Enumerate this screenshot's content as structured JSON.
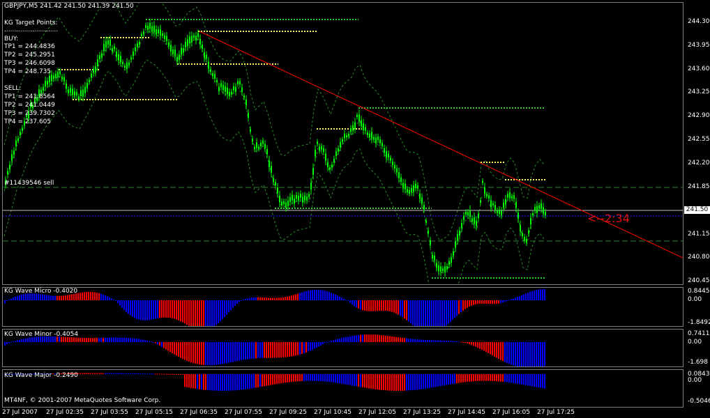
{
  "chart": {
    "symbol_header": "GBPJPY,M5  241.42 241.50 241.39 241.50",
    "panel_title": "KG Target Points:",
    "dotted_line": "...........................",
    "buy_header": "BUY:",
    "buy_tp1": "TP1 = 244.4836",
    "buy_tp2": "TP2 = 245.2951",
    "buy_tp3": "TP3 = 246.6098",
    "buy_tp4": "TP4 = 248.735",
    "sell_header": "SELL:",
    "sell_tp1": "TP1 = 241.8564",
    "sell_tp2": "TP2 = 241.0449",
    "sell_tp3": "TP3 = 239.7302",
    "sell_tp4": "TP4 = 237.605",
    "order_label": "#11439546 sell",
    "countdown": "<--2:34",
    "current_price": "241.50",
    "copyright": "MT4NF, © 2001-2007 MetaQuotes Software Corp."
  },
  "price_axis": [
    "244.30",
    "243.95",
    "243.60",
    "243.25",
    "242.90",
    "242.55",
    "242.20",
    "241.85",
    "241.15",
    "240.80",
    "240.45"
  ],
  "indicators": {
    "micro": {
      "title": "KG Wave Micro  -0.4020",
      "axis": [
        "0.8445",
        "0.00",
        "-1.8492"
      ]
    },
    "minor": {
      "title": "KG Wave Minor  -0.4054",
      "axis": [
        "0.7411",
        "0.00",
        "-1.698"
      ]
    },
    "major": {
      "title": "KG Wave Major  -0.2490",
      "axis": [
        "0.0843",
        "0.00",
        "-0.5046"
      ]
    }
  },
  "time_axis": [
    "27 Jul 2007",
    "27 Jul 02:35",
    "27 Jul 03:55",
    "27 Jul 05:15",
    "27 Jul 06:35",
    "27 Jul 07:55",
    "27 Jul 09:25",
    "27 Jul 10:45",
    "27 Jul 12:05",
    "27 Jul 13:25",
    "27 Jul 14:45",
    "27 Jul 16:05",
    "27 Jul 17:25"
  ],
  "colors": {
    "candle": "#00ff00",
    "bull_hist": "#0000ff",
    "bear_hist": "#ff0000",
    "trend": "#ff0000",
    "levels_yellow": "#ffff66",
    "levels_green": "#33cc33"
  }
}
